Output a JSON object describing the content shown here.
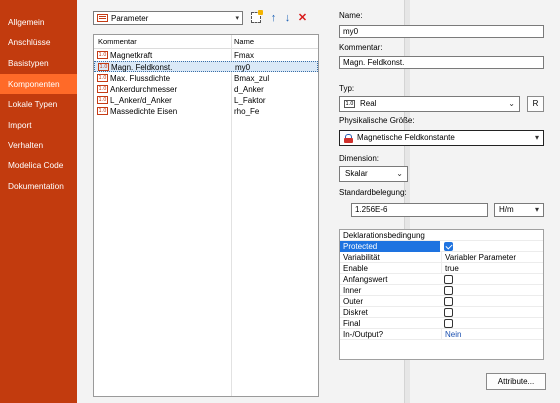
{
  "sidebar": {
    "items": [
      {
        "label": "Allgemein"
      },
      {
        "label": "Anschlüsse"
      },
      {
        "label": "Basistypen"
      },
      {
        "label": "Komponenten"
      },
      {
        "label": "Lokale Typen"
      },
      {
        "label": "Import"
      },
      {
        "label": "Verhalten"
      },
      {
        "label": "Modelica Code"
      },
      {
        "label": "Dokumentation"
      }
    ],
    "active_index": 3
  },
  "component_list": {
    "filter_value": "Parameter",
    "columns": [
      "Kommentar",
      "Name"
    ],
    "row_icon_text": "1.0",
    "rows": [
      {
        "comment": "Magnetkraft",
        "name": "Fmax"
      },
      {
        "comment": "Magn. Feldkonst.",
        "name": "my0"
      },
      {
        "comment": "Max. Flussdichte",
        "name": "Bmax_zul"
      },
      {
        "comment": "Ankerdurchmesser",
        "name": "d_Anker"
      },
      {
        "comment": "L_Anker/d_Anker",
        "name": "L_Faktor"
      },
      {
        "comment": "Massedichte Eisen",
        "name": "rho_Fe"
      }
    ],
    "selected_index": 1
  },
  "details": {
    "name_label": "Name:",
    "name_value": "my0",
    "comment_label": "Kommentar:",
    "comment_value": "Magn. Feldkonst.",
    "type_label": "Typ:",
    "type_icon_text": "1.0",
    "type_value": "Real",
    "type_button": "R",
    "quantity_label": "Physikalische Größe:",
    "quantity_value": "Magnetische Feldkonstante",
    "dimension_label": "Dimension:",
    "dimension_value": "Skalar",
    "default_label": "Standardbelegung:",
    "default_value": "1.256E-6",
    "unit_value": "H/m",
    "declaration_header": "Deklarationsbedingung",
    "properties": [
      {
        "key": "Protected",
        "kind": "check",
        "checked": true
      },
      {
        "key": "Variabilität",
        "kind": "text",
        "value": "Variabler Parameter"
      },
      {
        "key": "Enable",
        "kind": "text",
        "value": "true"
      },
      {
        "key": "Anfangswert",
        "kind": "check",
        "checked": false
      },
      {
        "key": "Inner",
        "kind": "check",
        "checked": false
      },
      {
        "key": "Outer",
        "kind": "check",
        "checked": false
      },
      {
        "key": "Diskret",
        "kind": "check",
        "checked": false
      },
      {
        "key": "Final",
        "kind": "check",
        "checked": false
      },
      {
        "key": "In-/Output?",
        "kind": "link",
        "value": "Nein"
      }
    ],
    "attributes_button": "Attribute..."
  },
  "colors": {
    "sidebar_bg": "#c23b0e",
    "sidebar_active": "#ff6a28",
    "selection": "#1e73e0",
    "link": "#1a4fb0"
  }
}
